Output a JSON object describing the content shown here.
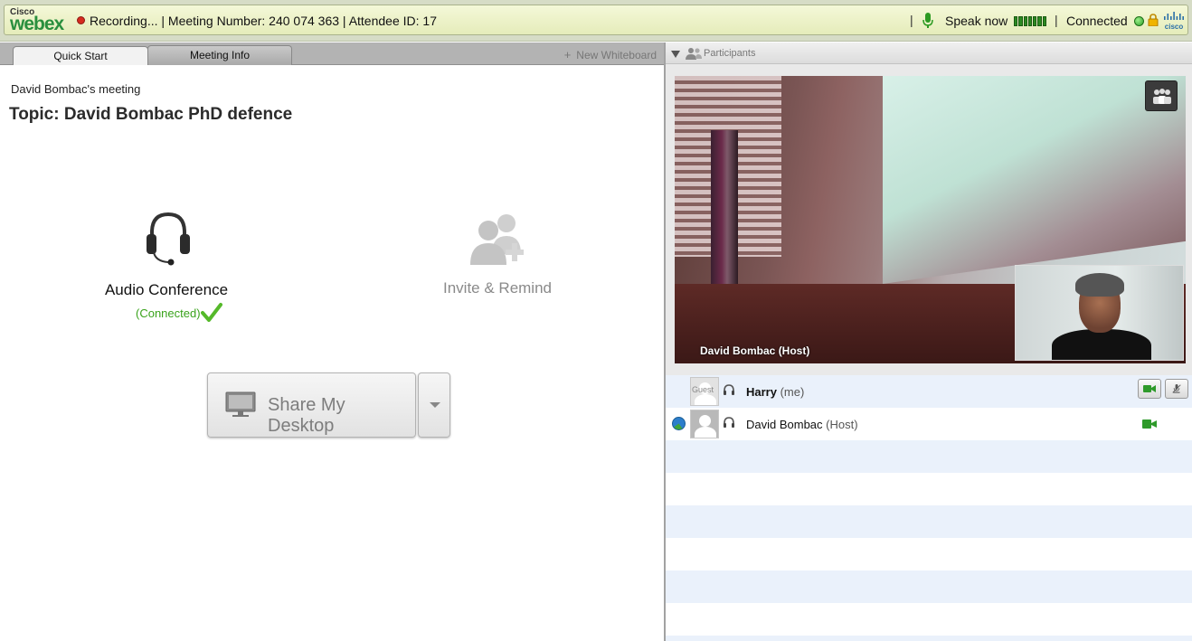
{
  "topbar": {
    "logo_small": "Cisco",
    "logo_large": "webex",
    "recording": "Recording...",
    "meeting_number": "Meeting Number: 240 074 363",
    "attendee_id": "Attendee ID: 17",
    "separator": "|",
    "speak_now": "Speak now",
    "connected": "Connected",
    "brand_logo": "cisco",
    "accent_green": "#2a8f3e",
    "recording_color": "#d62b1f"
  },
  "tabs": {
    "quick_start": "Quick Start",
    "meeting_info": "Meeting Info",
    "new_whiteboard_plus": "+",
    "new_whiteboard": "New Whiteboard"
  },
  "quick_start": {
    "owner": "David Bombac's meeting",
    "topic": "Topic: David Bombac PhD defence",
    "audio_label": "Audio Conference",
    "audio_state": "(Connected)",
    "invite_label": "Invite & Remind",
    "share_label": "Share My Desktop",
    "audio_icon": "headset-icon",
    "invite_icon": "people-add-icon",
    "share_icon": "monitor-icon"
  },
  "participants": {
    "title": "Participants",
    "video_name": "David Bombac (Host)",
    "list": [
      {
        "avatar_tag": "Guest",
        "name": "Harry",
        "role": "(me)"
      },
      {
        "name": "David Bombac",
        "role": "(Host)"
      }
    ]
  }
}
